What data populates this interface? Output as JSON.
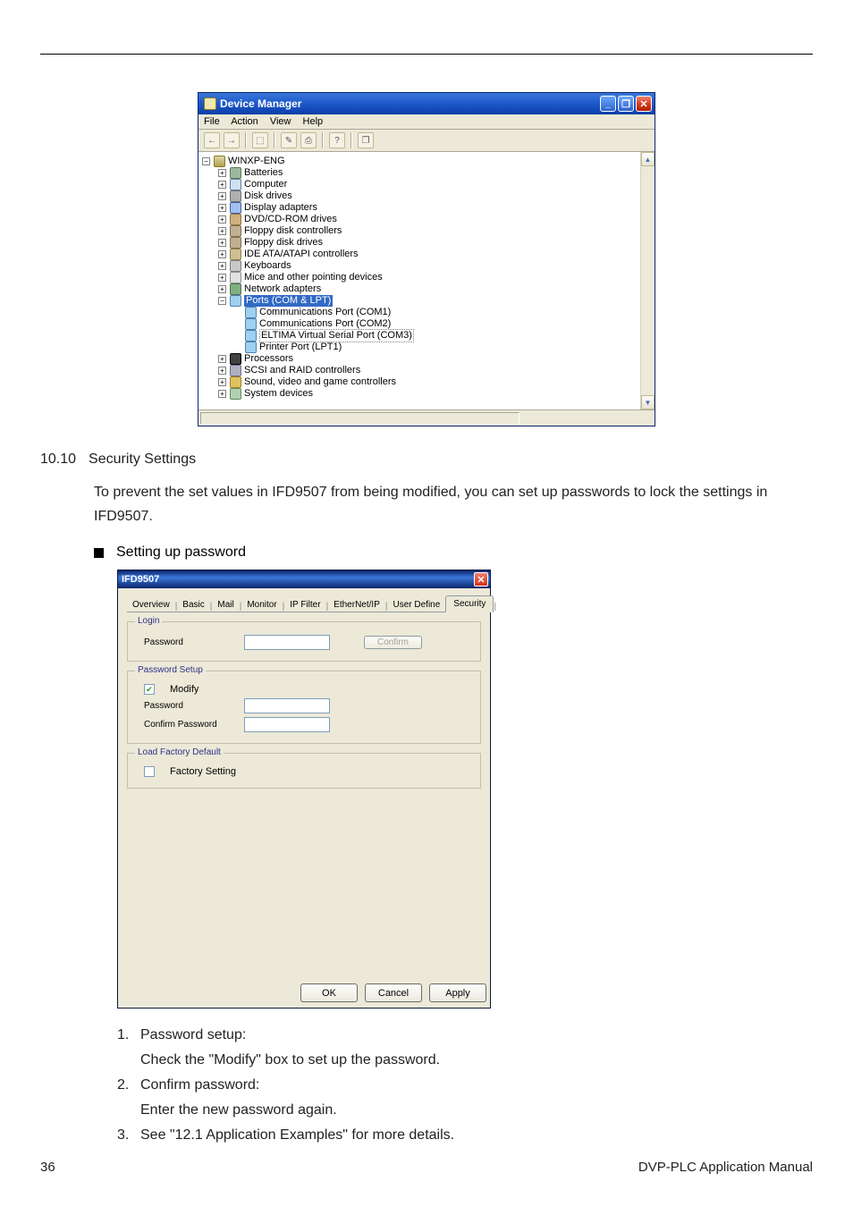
{
  "devmgr": {
    "title": "Device Manager",
    "menu": {
      "file": "File",
      "action": "Action",
      "view": "View",
      "help": "Help"
    },
    "tool": {
      "back": "←",
      "fwd": "→",
      "up": "⬚",
      "prop": "✎",
      "print": "⎙",
      "help": "?",
      "scan": "❐"
    },
    "ctrls": {
      "min": "_",
      "max": "❐",
      "close": "✕"
    },
    "scroll": {
      "up": "▲",
      "down": "▼"
    },
    "tree": {
      "root": "WINXP-ENG",
      "batteries": "Batteries",
      "computer": "Computer",
      "diskdrives": "Disk drives",
      "display": "Display adapters",
      "dvd": "DVD/CD-ROM drives",
      "fdc": "Floppy disk controllers",
      "fdd": "Floppy disk drives",
      "ide": "IDE ATA/ATAPI controllers",
      "kb": "Keyboards",
      "mouse": "Mice and other pointing devices",
      "net": "Network adapters",
      "ports": "Ports (COM & LPT)",
      "com1": "Communications Port (COM1)",
      "com2": "Communications Port (COM2)",
      "eltima": "ELTIMA Virtual Serial Port (COM3)",
      "lpt1": "Printer Port (LPT1)",
      "proc": "Processors",
      "raid": "SCSI and RAID controllers",
      "sound": "Sound, video and game controllers",
      "sys": "System devices"
    }
  },
  "sec": {
    "num": "10.10",
    "title": "Security Settings",
    "para": "To prevent the set values in IFD9507 from being modified, you can set up passwords to lock the settings in IFD9507.",
    "bullet": "Setting up password"
  },
  "ifd": {
    "title": "IFD9507",
    "close": "✕",
    "tabs": {
      "overview": "Overview",
      "basic": "Basic",
      "mail": "Mail",
      "monitor": "Monitor",
      "ipfilter": "IP Filter",
      "enip": "EtherNet/IP",
      "userdef": "User Define",
      "security": "Security"
    },
    "login": {
      "label": "Login",
      "password": "Password",
      "confirm": "Confirm"
    },
    "pwsetup": {
      "label": "Password Setup",
      "modify": "Modify",
      "password": "Password",
      "confirmpw": "Confirm Password"
    },
    "factory": {
      "label": "Load Factory Default",
      "setting": "Factory Setting"
    },
    "buttons": {
      "ok": "OK",
      "cancel": "Cancel",
      "apply": "Apply"
    }
  },
  "list": {
    "i1n": "1.",
    "i1t": "Password setup:",
    "i1s": "Check the \"Modify\" box to set up the password.",
    "i2n": "2.",
    "i2t": "Confirm password:",
    "i2s": "Enter the new password again.",
    "i3n": "3.",
    "i3t": "See \"12.1 Application Examples\" for more details."
  },
  "footer": {
    "page": "36",
    "manual": "DVP-PLC  Application  Manual"
  }
}
